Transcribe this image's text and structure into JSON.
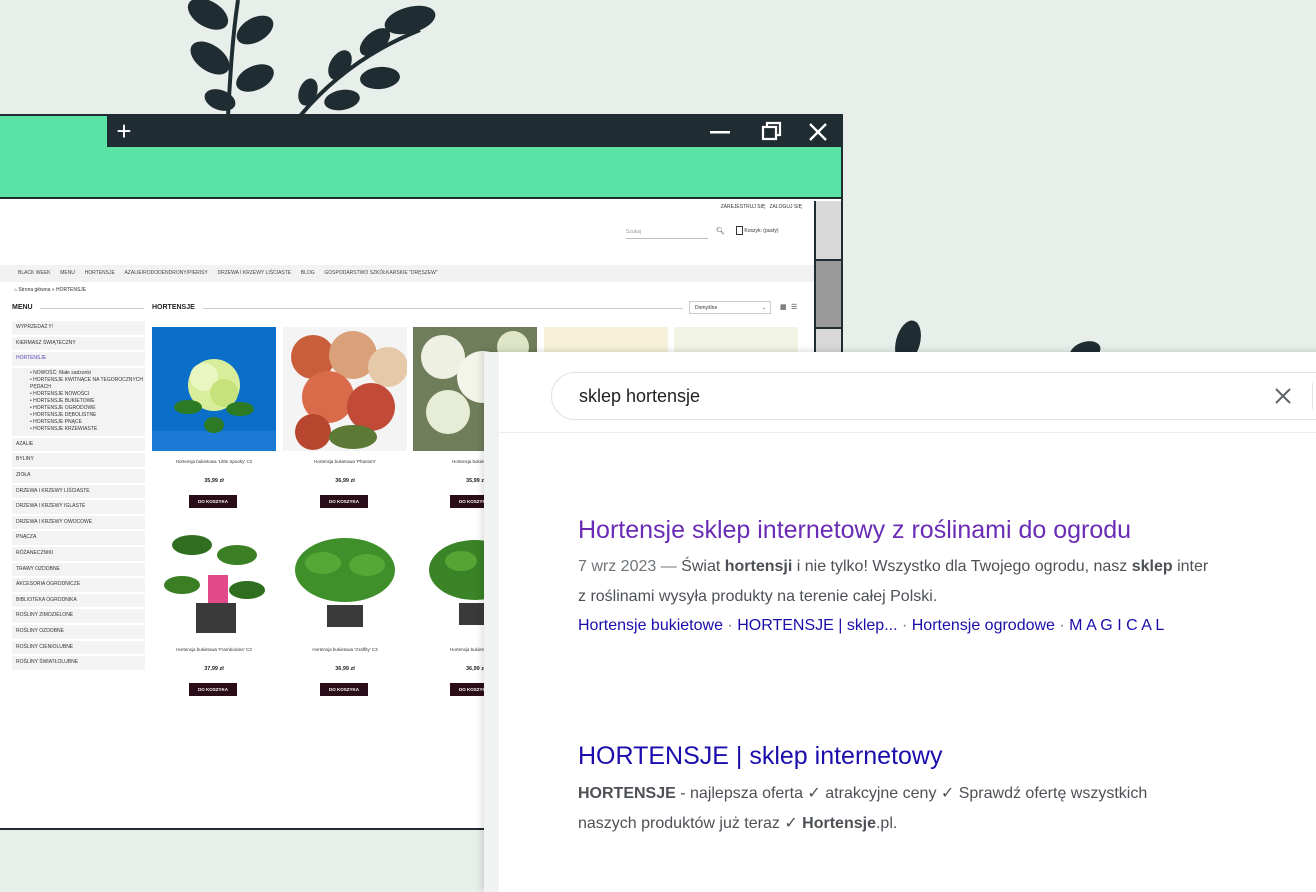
{
  "colors": {
    "accent_green": "#5ae3a4",
    "dark": "#1f2d33",
    "visited": "#6a2bb5",
    "link": "#1a0dab"
  },
  "shop": {
    "top_links": [
      "ZAREJESTRUJ SIĘ",
      "ZALOGUJ SIĘ"
    ],
    "search_placeholder": "Szukaj",
    "cart": "Koszyk: (pusty)",
    "nav": [
      "BLACK WEEK",
      "MENU",
      "HORTENSJE",
      "AZALIE/RODODENDRONY/PIERISY",
      "DRZEWA I KRZEWY LIŚCIASTE",
      "BLOG",
      "GOSPODARSTWO SZKÓŁKARSKIE \"DRĘSZEW\""
    ],
    "breadcrumb": [
      "Strona główna",
      "»",
      "HORTENSJE"
    ],
    "menu_title": "MENU",
    "section_title": "HORTENSJE",
    "sort_value": "Domyślne",
    "menu_top": [
      "WYPRZEDAŻ !!!",
      "KIERMASZ ŚWIĄTECZNY"
    ],
    "menu_active": "HORTENSJE",
    "menu_sub": [
      "NOWOŚĆ: Małe sadzonki",
      "HORTENSJE KWITNĄCE NA TEGOROCZNYCH PĘDACH",
      "HORTENSJE NOWOŚCI",
      "HORTENSJE BUKIETOWE",
      "HORTENSJE OGRODOWE",
      "HORTENSJE DĘBOLISTNE",
      "HORTENSJE PNĄCE",
      "HORTENSJE KRZEWIASTE"
    ],
    "menu_rest": [
      "AZALIE",
      "BYLINY",
      "ZIOŁA",
      "DRZEWA I KRZEWY LIŚCIASTE",
      "DRZEWA I KRZEWY IGLASTE",
      "DRZEWA I KRZEWY OWOCOWE",
      "PNĄCZA",
      "RÓŻANECZNIKI",
      "TRAWY OZDOBNE",
      "AKCESORIA OGRODNICZE",
      "BIBLIOTEKA OGRODNIKA",
      "ROŚLINY ZIMOZIELONE",
      "ROŚLINY OZDOBNE",
      "ROŚLINY CIENIOLUBNE",
      "ROŚLINY ŚWIATŁOLUBNE"
    ],
    "products_row1": [
      {
        "name": "Hortensja bukietowa 'Little Spooky' C2",
        "price": "35,99 zł"
      },
      {
        "name": "Hortensja bukietowa 'Phantom'",
        "price": "36,99 zł"
      },
      {
        "name": "Hortensja bukietowa 'S",
        "price": "35,99 z"
      }
    ],
    "products_row2": [
      {
        "name": "Hortensja bukietowa 'Framboisine' C3",
        "price": "37,99 zł"
      },
      {
        "name": "Hortensja bukietowa 'Graffity' C3",
        "price": "36,99 zł"
      },
      {
        "name": "Hortensja bukietowa 'GR",
        "price": "36,99 z"
      }
    ],
    "cart_button": "DO KOSZYKA"
  },
  "google": {
    "query": "sklep hortensje",
    "result1": {
      "title": "Hortensje sklep internetowy z roślinami do ogrodu",
      "date": "7 wrz 2023 —",
      "s1": " Świat ",
      "b1": "hortensji",
      "s2": " i nie tylko! Wszystko dla Twojego ogrodu, nasz ",
      "b2": "sklep",
      "s3": " inter",
      "line2": "z roślinami wysyła produkty na terenie całej Polski.",
      "links": [
        "Hortensje bukietowe",
        "HORTENSJE | sklep...",
        "Hortensje ogrodowe",
        "M A G I C A L"
      ],
      "sep": " · "
    },
    "result2": {
      "title": "HORTENSJE | sklep internetowy",
      "b1": "HORTENSJE",
      "s1": " - najlepsza oferta ✓ atrakcyjne ceny ✓ Sprawdź ofertę wszystkich",
      "s2": "naszych produktów już teraz ✓ ",
      "b2": "Hortensje",
      "s3": ".pl."
    }
  }
}
